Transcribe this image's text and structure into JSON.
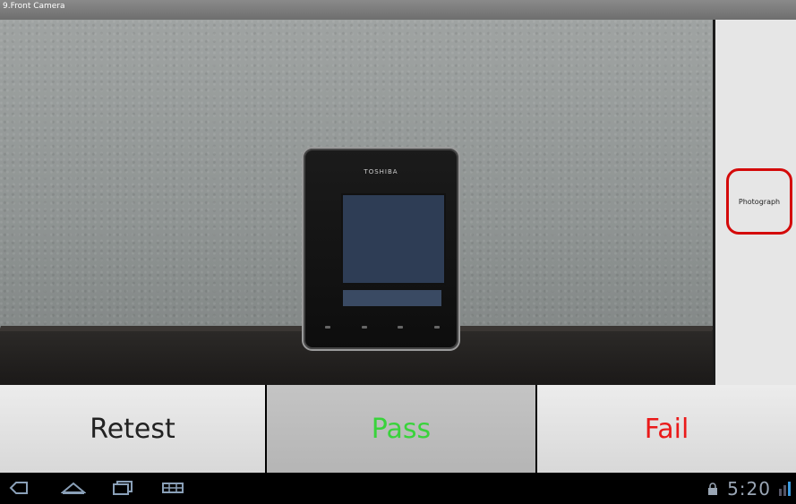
{
  "window": {
    "title": "9.Front Camera"
  },
  "preview": {
    "device_brand": "TOSHIBA"
  },
  "side_panel": {
    "photo_button_label": "Photograph"
  },
  "actions": {
    "retest_label": "Retest",
    "pass_label": "Pass",
    "fail_label": "Fail"
  },
  "status_bar": {
    "time": "5:20"
  },
  "colors": {
    "pass": "#39d33b",
    "fail": "#ea1a1a",
    "photo_button_border": "#d40a0a"
  },
  "icons": {
    "back": "back-icon",
    "home": "home-icon",
    "recents": "recents-icon",
    "menu": "menu-icon",
    "lock": "lock-icon",
    "signal": "signal-icon"
  }
}
